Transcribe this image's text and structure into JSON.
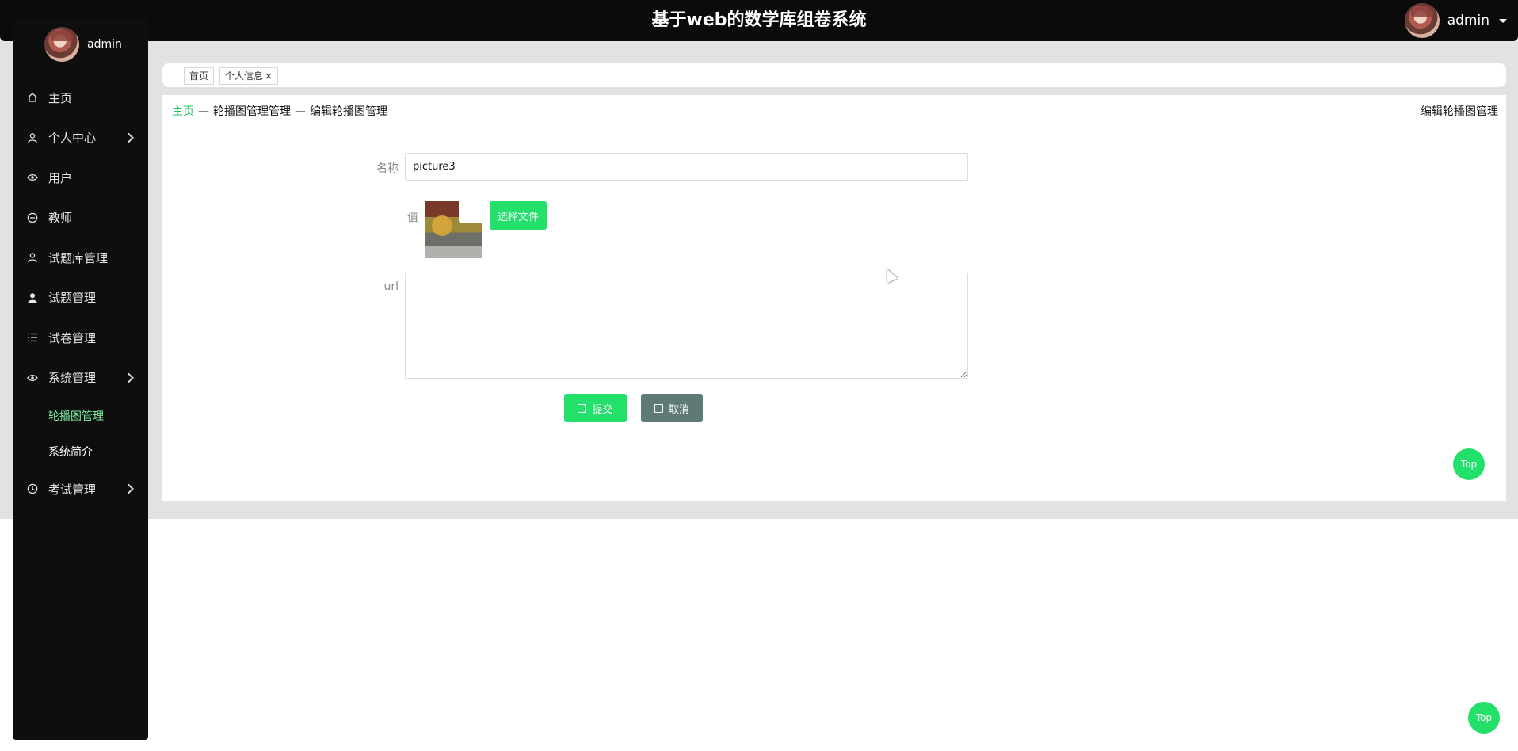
{
  "header": {
    "title": "基于web的数学库组卷系统",
    "username": "admin"
  },
  "sidebar": {
    "username": "admin",
    "items": [
      {
        "label": "主页",
        "icon": "home-icon",
        "has_arrow": false
      },
      {
        "label": "个人中心",
        "icon": "user-icon",
        "has_arrow": true
      },
      {
        "label": "用户",
        "icon": "eye-icon",
        "has_arrow": false
      },
      {
        "label": "教师",
        "icon": "minus-circle-icon",
        "has_arrow": false
      },
      {
        "label": "试题库管理",
        "icon": "user-icon",
        "has_arrow": false
      },
      {
        "label": "试题管理",
        "icon": "user-solid-icon",
        "has_arrow": false
      },
      {
        "label": "试卷管理",
        "icon": "list-icon",
        "has_arrow": false
      },
      {
        "label": "系统管理",
        "icon": "eye-icon",
        "has_arrow": true
      },
      {
        "label": "考试管理",
        "icon": "clock-icon",
        "has_arrow": true
      }
    ],
    "sub_items": [
      {
        "label": "轮播图管理",
        "active": true
      },
      {
        "label": "系统简介",
        "active": false
      }
    ]
  },
  "tabs": [
    {
      "label": "首页"
    },
    {
      "label": "个人信息",
      "close": "×"
    }
  ],
  "breadcrumb": {
    "home": "主页",
    "sep": "—",
    "level1": "轮播图管理管理",
    "level2": "编辑轮播图管理"
  },
  "panel_title": "编辑轮播图管理",
  "form": {
    "name_label": "名称",
    "name_value": "picture3",
    "value_label": "值",
    "file_button": "选择文件",
    "url_label": "url",
    "url_value": "",
    "submit_label": "提交",
    "cancel_label": "取消"
  },
  "top_button": "Top",
  "colors": {
    "accent": "#22e06a",
    "sidebar_bg": "#0e0e0e",
    "cancel": "#5f7a74",
    "active_menu": "#7df0a0"
  }
}
